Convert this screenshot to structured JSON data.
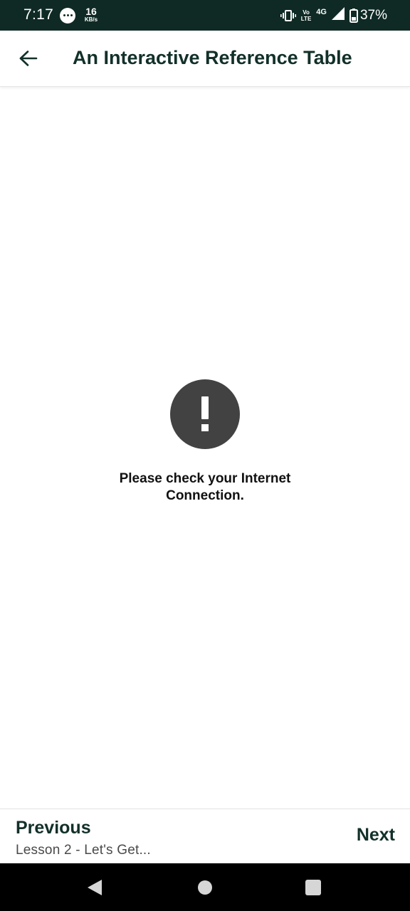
{
  "status_bar": {
    "time": "7:17",
    "speed_value": "16",
    "speed_unit": "KB/s",
    "volte_top": "Vo",
    "volte_bottom": "LTE",
    "network": "4G",
    "battery": "37%",
    "icons": [
      "message-icon",
      "vibrate-icon",
      "signal-icon",
      "battery-icon"
    ]
  },
  "app_bar": {
    "title": "An Interactive Reference Table",
    "back_icon": "arrow-left-icon"
  },
  "content": {
    "error_icon": "exclamation-icon",
    "error_message": "Please check your Internet Connection."
  },
  "bottom_nav": {
    "previous_label": "Previous",
    "previous_subtitle": "Lesson 2 - Let's Get...",
    "next_label": "Next"
  },
  "system_nav": {
    "icons": [
      "nav-back-icon",
      "nav-home-icon",
      "nav-recents-icon"
    ]
  },
  "colors": {
    "status_bar_bg": "#0f2a24",
    "title_text": "#123029",
    "error_icon_bg": "#424242"
  }
}
